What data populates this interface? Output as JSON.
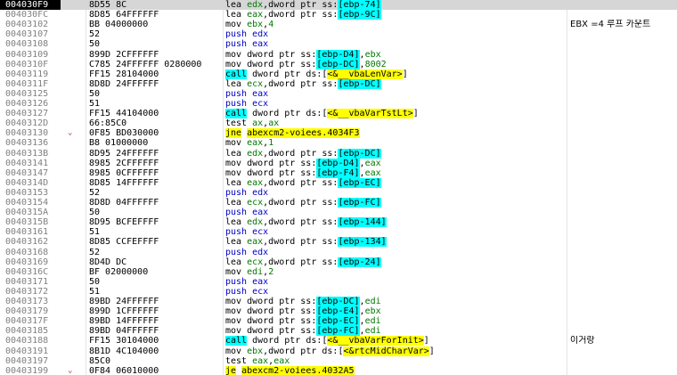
{
  "selected_row": 0,
  "rows": [
    {
      "addr": "004030F9",
      "arrow": "",
      "bytes": "8D55 8C",
      "instr": [
        {
          "t": "mn",
          "v": "lea "
        },
        {
          "t": "reg",
          "v": "edx"
        },
        {
          "t": "pl",
          "v": ",dword ptr ss:"
        },
        {
          "t": "mem",
          "v": "[ebp-74]"
        }
      ],
      "comment": ""
    },
    {
      "addr": "004030FC",
      "arrow": "",
      "bytes": "8D85 64FFFFFF",
      "instr": [
        {
          "t": "mn",
          "v": "lea "
        },
        {
          "t": "reg",
          "v": "eax"
        },
        {
          "t": "pl",
          "v": ",dword ptr ss:"
        },
        {
          "t": "mem",
          "v": "[ebp-9C]"
        }
      ],
      "comment": ""
    },
    {
      "addr": "00403102",
      "arrow": "",
      "bytes": "BB 04000000",
      "instr": [
        {
          "t": "mn",
          "v": "mov "
        },
        {
          "t": "reg",
          "v": "ebx"
        },
        {
          "t": "pl",
          "v": ","
        },
        {
          "t": "num",
          "v": "4"
        }
      ],
      "comment": "EBX =4 루프 카운트"
    },
    {
      "addr": "00403107",
      "arrow": "",
      "bytes": "52",
      "instr": [
        {
          "t": "push",
          "v": "push edx"
        }
      ],
      "comment": ""
    },
    {
      "addr": "00403108",
      "arrow": "",
      "bytes": "50",
      "instr": [
        {
          "t": "push",
          "v": "push eax"
        }
      ],
      "comment": ""
    },
    {
      "addr": "00403109",
      "arrow": "",
      "bytes": "899D 2CFFFFFF",
      "instr": [
        {
          "t": "mn",
          "v": "mov dword ptr ss:"
        },
        {
          "t": "mem",
          "v": "[ebp-D4]"
        },
        {
          "t": "pl",
          "v": ","
        },
        {
          "t": "reg",
          "v": "ebx"
        }
      ],
      "comment": ""
    },
    {
      "addr": "0040310F",
      "arrow": "",
      "bytes": "C785 24FFFFFF 0280000",
      "instr": [
        {
          "t": "mn",
          "v": "mov dword ptr ss:"
        },
        {
          "t": "mem",
          "v": "[ebp-DC]"
        },
        {
          "t": "pl",
          "v": ","
        },
        {
          "t": "num",
          "v": "8002"
        }
      ],
      "comment": ""
    },
    {
      "addr": "00403119",
      "arrow": "",
      "bytes": "FF15 28104000",
      "instr": [
        {
          "t": "call",
          "v": "call"
        },
        {
          "t": "pl",
          "v": " dword ptr ds:["
        },
        {
          "t": "sym",
          "v": "<&__vbaLenVar>"
        },
        {
          "t": "pl",
          "v": "]"
        }
      ],
      "comment": ""
    },
    {
      "addr": "0040311F",
      "arrow": "",
      "bytes": "8D8D 24FFFFFF",
      "instr": [
        {
          "t": "mn",
          "v": "lea "
        },
        {
          "t": "reg",
          "v": "ecx"
        },
        {
          "t": "pl",
          "v": ",dword ptr ss:"
        },
        {
          "t": "mem",
          "v": "[ebp-DC]"
        }
      ],
      "comment": ""
    },
    {
      "addr": "00403125",
      "arrow": "",
      "bytes": "50",
      "instr": [
        {
          "t": "push",
          "v": "push eax"
        }
      ],
      "comment": ""
    },
    {
      "addr": "00403126",
      "arrow": "",
      "bytes": "51",
      "instr": [
        {
          "t": "push",
          "v": "push ecx"
        }
      ],
      "comment": ""
    },
    {
      "addr": "00403127",
      "arrow": "",
      "bytes": "FF15 44104000",
      "instr": [
        {
          "t": "call",
          "v": "call"
        },
        {
          "t": "pl",
          "v": " dword ptr ds:["
        },
        {
          "t": "sym",
          "v": "<&__vbaVarTstLt>"
        },
        {
          "t": "pl",
          "v": "]"
        }
      ],
      "comment": ""
    },
    {
      "addr": "0040312D",
      "arrow": "",
      "bytes": "66:85C0",
      "instr": [
        {
          "t": "mn",
          "v": "test "
        },
        {
          "t": "reg",
          "v": "ax"
        },
        {
          "t": "pl",
          "v": ","
        },
        {
          "t": "reg",
          "v": "ax"
        }
      ],
      "comment": ""
    },
    {
      "addr": "00403130",
      "arrow": "v",
      "bytes": "0F85 BD030000",
      "instr": [
        {
          "t": "jmp",
          "v": "jne"
        },
        {
          "t": "pl",
          "v": " "
        },
        {
          "t": "jmp",
          "v": "abexcm2-voiees.4034F3"
        }
      ],
      "comment": ""
    },
    {
      "addr": "00403136",
      "arrow": "",
      "bytes": "B8 01000000",
      "instr": [
        {
          "t": "mn",
          "v": "mov "
        },
        {
          "t": "reg",
          "v": "eax"
        },
        {
          "t": "pl",
          "v": ","
        },
        {
          "t": "num",
          "v": "1"
        }
      ],
      "comment": ""
    },
    {
      "addr": "0040313B",
      "arrow": "",
      "bytes": "8D95 24FFFFFF",
      "instr": [
        {
          "t": "mn",
          "v": "lea "
        },
        {
          "t": "reg",
          "v": "edx"
        },
        {
          "t": "pl",
          "v": ",dword ptr ss:"
        },
        {
          "t": "mem",
          "v": "[ebp-DC]"
        }
      ],
      "comment": ""
    },
    {
      "addr": "00403141",
      "arrow": "",
      "bytes": "8985 2CFFFFFF",
      "instr": [
        {
          "t": "mn",
          "v": "mov dword ptr ss:"
        },
        {
          "t": "mem",
          "v": "[ebp-D4]"
        },
        {
          "t": "pl",
          "v": ","
        },
        {
          "t": "reg",
          "v": "eax"
        }
      ],
      "comment": ""
    },
    {
      "addr": "00403147",
      "arrow": "",
      "bytes": "8985 0CFFFFFF",
      "instr": [
        {
          "t": "mn",
          "v": "mov dword ptr ss:"
        },
        {
          "t": "mem",
          "v": "[ebp-F4]"
        },
        {
          "t": "pl",
          "v": ","
        },
        {
          "t": "reg",
          "v": "eax"
        }
      ],
      "comment": ""
    },
    {
      "addr": "0040314D",
      "arrow": "",
      "bytes": "8D85 14FFFFFF",
      "instr": [
        {
          "t": "mn",
          "v": "lea "
        },
        {
          "t": "reg",
          "v": "eax"
        },
        {
          "t": "pl",
          "v": ",dword ptr ss:"
        },
        {
          "t": "mem",
          "v": "[ebp-EC]"
        }
      ],
      "comment": ""
    },
    {
      "addr": "00403153",
      "arrow": "",
      "bytes": "52",
      "instr": [
        {
          "t": "push",
          "v": "push edx"
        }
      ],
      "comment": ""
    },
    {
      "addr": "00403154",
      "arrow": "",
      "bytes": "8D8D 04FFFFFF",
      "instr": [
        {
          "t": "mn",
          "v": "lea "
        },
        {
          "t": "reg",
          "v": "ecx"
        },
        {
          "t": "pl",
          "v": ",dword ptr ss:"
        },
        {
          "t": "mem",
          "v": "[ebp-FC]"
        }
      ],
      "comment": ""
    },
    {
      "addr": "0040315A",
      "arrow": "",
      "bytes": "50",
      "instr": [
        {
          "t": "push",
          "v": "push eax"
        }
      ],
      "comment": ""
    },
    {
      "addr": "0040315B",
      "arrow": "",
      "bytes": "8D95 BCFEFFFF",
      "instr": [
        {
          "t": "mn",
          "v": "lea "
        },
        {
          "t": "reg",
          "v": "edx"
        },
        {
          "t": "pl",
          "v": ",dword ptr ss:"
        },
        {
          "t": "mem",
          "v": "[ebp-144]"
        }
      ],
      "comment": ""
    },
    {
      "addr": "00403161",
      "arrow": "",
      "bytes": "51",
      "instr": [
        {
          "t": "push",
          "v": "push ecx"
        }
      ],
      "comment": ""
    },
    {
      "addr": "00403162",
      "arrow": "",
      "bytes": "8D85 CCFEFFFF",
      "instr": [
        {
          "t": "mn",
          "v": "lea "
        },
        {
          "t": "reg",
          "v": "eax"
        },
        {
          "t": "pl",
          "v": ",dword ptr ss:"
        },
        {
          "t": "mem",
          "v": "[ebp-134]"
        }
      ],
      "comment": ""
    },
    {
      "addr": "00403168",
      "arrow": "",
      "bytes": "52",
      "instr": [
        {
          "t": "push",
          "v": "push edx"
        }
      ],
      "comment": ""
    },
    {
      "addr": "00403169",
      "arrow": "",
      "bytes": "8D4D DC",
      "instr": [
        {
          "t": "mn",
          "v": "lea "
        },
        {
          "t": "reg",
          "v": "ecx"
        },
        {
          "t": "pl",
          "v": ",dword ptr ss:"
        },
        {
          "t": "mem",
          "v": "[ebp-24]"
        }
      ],
      "comment": ""
    },
    {
      "addr": "0040316C",
      "arrow": "",
      "bytes": "BF 02000000",
      "instr": [
        {
          "t": "mn",
          "v": "mov "
        },
        {
          "t": "reg",
          "v": "edi"
        },
        {
          "t": "pl",
          "v": ","
        },
        {
          "t": "num",
          "v": "2"
        }
      ],
      "comment": ""
    },
    {
      "addr": "00403171",
      "arrow": "",
      "bytes": "50",
      "instr": [
        {
          "t": "push",
          "v": "push eax"
        }
      ],
      "comment": ""
    },
    {
      "addr": "00403172",
      "arrow": "",
      "bytes": "51",
      "instr": [
        {
          "t": "push",
          "v": "push ecx"
        }
      ],
      "comment": ""
    },
    {
      "addr": "00403173",
      "arrow": "",
      "bytes": "89BD 24FFFFFF",
      "instr": [
        {
          "t": "mn",
          "v": "mov dword ptr ss:"
        },
        {
          "t": "mem",
          "v": "[ebp-DC]"
        },
        {
          "t": "pl",
          "v": ","
        },
        {
          "t": "reg",
          "v": "edi"
        }
      ],
      "comment": ""
    },
    {
      "addr": "00403179",
      "arrow": "",
      "bytes": "899D 1CFFFFFF",
      "instr": [
        {
          "t": "mn",
          "v": "mov dword ptr ss:"
        },
        {
          "t": "mem",
          "v": "[ebp-E4]"
        },
        {
          "t": "pl",
          "v": ","
        },
        {
          "t": "reg",
          "v": "ebx"
        }
      ],
      "comment": ""
    },
    {
      "addr": "0040317F",
      "arrow": "",
      "bytes": "89BD 14FFFFFF",
      "instr": [
        {
          "t": "mn",
          "v": "mov dword ptr ss:"
        },
        {
          "t": "mem",
          "v": "[ebp-EC]"
        },
        {
          "t": "pl",
          "v": ","
        },
        {
          "t": "reg",
          "v": "edi"
        }
      ],
      "comment": ""
    },
    {
      "addr": "00403185",
      "arrow": "",
      "bytes": "89BD 04FFFFFF",
      "instr": [
        {
          "t": "mn",
          "v": "mov dword ptr ss:"
        },
        {
          "t": "mem",
          "v": "[ebp-FC]"
        },
        {
          "t": "pl",
          "v": ","
        },
        {
          "t": "reg",
          "v": "edi"
        }
      ],
      "comment": ""
    },
    {
      "addr": "00403188",
      "arrow": "",
      "bytes": "FF15 30104000",
      "instr": [
        {
          "t": "call",
          "v": "call"
        },
        {
          "t": "pl",
          "v": " dword ptr ds:["
        },
        {
          "t": "sym",
          "v": "<&__vbaVarForInit>"
        },
        {
          "t": "pl",
          "v": "]"
        }
      ],
      "comment": "이거랑"
    },
    {
      "addr": "00403191",
      "arrow": "",
      "bytes": "8B1D 4C104000",
      "instr": [
        {
          "t": "mn",
          "v": "mov "
        },
        {
          "t": "reg",
          "v": "ebx"
        },
        {
          "t": "pl",
          "v": ",dword ptr ds:["
        },
        {
          "t": "sym",
          "v": "<&rtcMidCharVar>"
        },
        {
          "t": "pl",
          "v": "]"
        }
      ],
      "comment": ""
    },
    {
      "addr": "00403197",
      "arrow": "",
      "bytes": "85C0",
      "instr": [
        {
          "t": "mn",
          "v": "test "
        },
        {
          "t": "reg",
          "v": "eax"
        },
        {
          "t": "pl",
          "v": ","
        },
        {
          "t": "reg",
          "v": "eax"
        }
      ],
      "comment": ""
    },
    {
      "addr": "00403199",
      "arrow": "v",
      "bytes": "0F84 06010000",
      "instr": [
        {
          "t": "jmp",
          "v": "je"
        },
        {
          "t": "pl",
          "v": " "
        },
        {
          "t": "jmp",
          "v": "abexcm2-voiees.4032A5"
        }
      ],
      "comment": ""
    }
  ]
}
